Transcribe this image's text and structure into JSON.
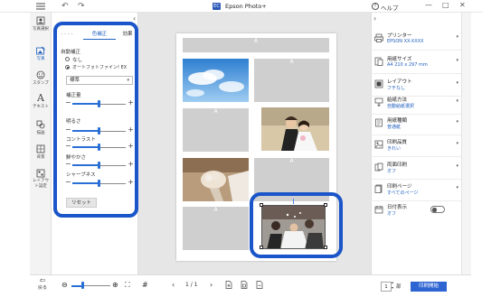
{
  "titlebar": {
    "app_icon_text": "EC",
    "app_title": "Epson Photo+",
    "help_label": "ヘルプ",
    "minimize": "—",
    "maximize": "□",
    "close": "✕"
  },
  "iconbar": {
    "items": [
      {
        "label": "写真選択",
        "icon": "photo-select-icon"
      },
      {
        "label": "写真",
        "icon": "photo-edit-icon"
      },
      {
        "label": "スタンプ",
        "icon": "stamp-icon"
      },
      {
        "label": "テキスト",
        "icon": "text-icon"
      },
      {
        "label": "描画",
        "icon": "draw-icon"
      },
      {
        "label": "背景",
        "icon": "background-icon"
      },
      {
        "label": "レイアウト設定",
        "icon": "layout-icon"
      }
    ]
  },
  "panel": {
    "tabs": [
      "- - - -",
      "色補正",
      "効果"
    ],
    "auto_correct_label": "自動補正",
    "option_none": "なし",
    "option_auto": "オートフォトファイン! EX",
    "select_value": "標準",
    "sliders": [
      {
        "label": "補正量",
        "value": 0.5
      },
      {
        "label": "明るさ",
        "value": 0.5
      },
      {
        "label": "コントラスト",
        "value": 0.5
      },
      {
        "label": "鮮やかさ",
        "value": 0.5
      },
      {
        "label": "シャープネス",
        "value": 0.5
      }
    ],
    "reset_label": "リセット"
  },
  "paper": {
    "slot_label": "A"
  },
  "settings": [
    {
      "title": "プリンター",
      "value": "EPSON XX-XXXX",
      "icon": "printer-icon"
    },
    {
      "title": "用紙サイズ",
      "value": "A4 210 x 297 mm",
      "icon": "paper-size-icon"
    },
    {
      "title": "レイアウト",
      "value": "フチなし",
      "icon": "layout-icon"
    },
    {
      "title": "給紙方法",
      "value": "自動給紙選択",
      "icon": "paper-feed-icon"
    },
    {
      "title": "用紙種類",
      "value": "普通紙",
      "icon": "paper-type-icon"
    },
    {
      "title": "印刷品質",
      "value": "きれい",
      "icon": "quality-icon"
    },
    {
      "title": "両面印刷",
      "value": "オフ",
      "icon": "duplex-icon"
    },
    {
      "title": "印刷ページ",
      "value": "すべてのページ",
      "icon": "pages-icon"
    },
    {
      "title": "日付表示",
      "value": "オフ",
      "icon": "date-icon"
    }
  ],
  "bottombar": {
    "back_label": "戻る",
    "page_indicator": "1 / 1",
    "copies": "1",
    "copies_unit": "部",
    "print_label": "印刷開始",
    "zoom_level": 0.3
  },
  "colors": {
    "accent": "#1a55c9",
    "print_button": "#2e65d3"
  }
}
